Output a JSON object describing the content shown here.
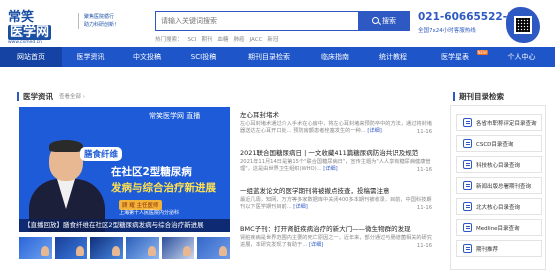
{
  "header": {
    "logo_text": "常笑医学网",
    "logo_badge": "医学网",
    "logo_prefix": "常笑",
    "logo_url": "www.cxmed.cn",
    "slogan_line1": "聚焦医院循行",
    "slogan_line2": "助力科研创新！"
  },
  "search": {
    "placeholder": "请输入关键词搜索",
    "button_label": "搜索",
    "hot_label": "热门搜索：",
    "hot_terms": [
      "SCI",
      "期刊",
      "血糖",
      "肺癌",
      "JACC",
      "新冠"
    ]
  },
  "contact": {
    "phone": "021-60665522-3",
    "service": "全国7x24小时客服热线"
  },
  "nav": {
    "items": [
      {
        "label": "网站首页",
        "active": true
      },
      {
        "label": "医学资讯"
      },
      {
        "label": "中文投稿"
      },
      {
        "label": "SCI投稿"
      },
      {
        "label": "期刊目录检索"
      },
      {
        "label": "临床指南"
      },
      {
        "label": "统计教程"
      },
      {
        "label": "医学星表",
        "badge": "NEW"
      },
      {
        "label": "个人中心"
      }
    ]
  },
  "news_section": {
    "title": "医学资讯",
    "more": "查看全部 ›"
  },
  "banner": {
    "brand": "常笑医学网  直播",
    "tag": "膳食纤维",
    "line1": "在社区2型糖尿病",
    "line2": "发病与综合治疗新进展",
    "speaker": "顾  耀  主任医师",
    "hospital": "上海第十人民医院内分泌科",
    "caption": "【直播回放】膳食纤维在社区2型糖尿病发病与综合治疗新进展"
  },
  "news": [
    {
      "title": "左心耳封堵术",
      "summary": "左心耳封堵术通过介入手术在心房中，将左心耳封堵来预防卒中的方法，通过将封堵器送达左心耳开口处... 预防房颤患者栓塞发生的一种...",
      "detail": "[详细]",
      "date": "11-16"
    },
    {
      "title": "2021联合国糖尿病日 | 一文收藏411篇糖尿病防治共识及规范",
      "summary": "2021年11月14日是第15个\"联合国糖尿病日\"，宣传主题为\"人人享有糖尿病健康管理\"，这是由世界卫生组织(WHO)...",
      "detail": "[详细]",
      "date": "11-16"
    },
    {
      "title": "一组蓝发论文的医学期刊将被撤点技查，投稿需注意",
      "summary": "最近几周，知网、万方等多家数据库中关闭400多本期刊被收录，目前，中国科技期刊以下医学期刊目前...",
      "detail": "[详细]",
      "date": "11-16"
    },
    {
      "title": "BMC子刊：打开肾脏疾病治疗的新大门——微生物群的发现",
      "summary": "肾脏疾病是世界范围内主要的死亡原因之一，近年来，部分通过与肠道菌相关的研究进展，本研究发现了有助于...",
      "detail": "[详细]",
      "date": "11-16"
    }
  ],
  "sidebar": {
    "title": "期刊目录检索",
    "items": [
      "各省市职称评定目录查询",
      "CSCD目录查询",
      "科技核心目录查询",
      "新闻出版总署期刊查询",
      "北大核心目录查询",
      "Medline目录查询",
      "期刊推荐"
    ]
  }
}
